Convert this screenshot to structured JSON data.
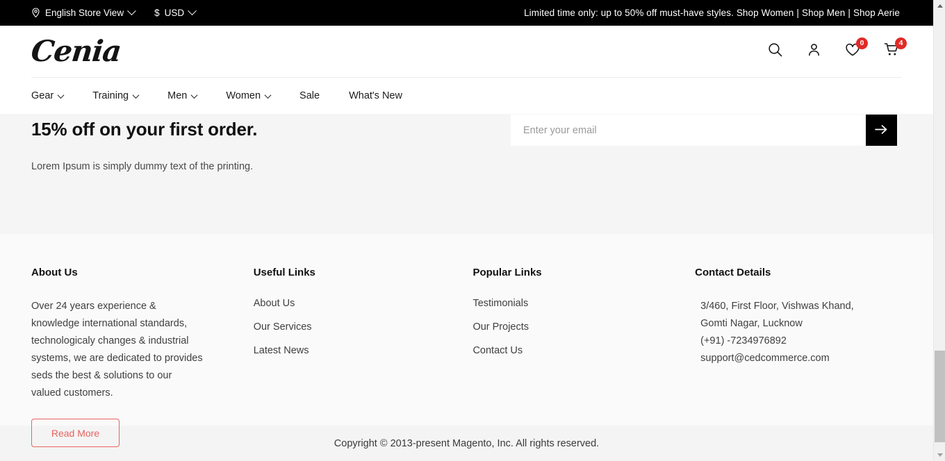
{
  "topbar": {
    "store_switcher": {
      "icon": "location-pin-icon",
      "label": "English Store View",
      "chevron": "chevron-down-icon"
    },
    "currency_switcher": {
      "icon": "dollar-icon",
      "symbol": "$",
      "label": "USD",
      "chevron": "chevron-down-icon"
    },
    "promo": {
      "text": "Limited time only: up to 50% off must-have styles.",
      "link1": "Shop Women",
      "sep1": "|",
      "link2": "Shop Men",
      "sep2": "|",
      "link3": "Shop Aerie"
    }
  },
  "header": {
    "logo": "Cenia",
    "icons": [
      {
        "name": "search-icon",
        "badge": null
      },
      {
        "name": "account-icon",
        "badge": null
      },
      {
        "name": "wishlist-heart-icon",
        "badge": "0"
      },
      {
        "name": "cart-icon",
        "badge": "4"
      }
    ],
    "badge_color": "#e02b27"
  },
  "nav": {
    "items": [
      {
        "label": "Gear",
        "has_chevron": true
      },
      {
        "label": "Training",
        "has_chevron": true
      },
      {
        "label": "Men",
        "has_chevron": true
      },
      {
        "label": "Women",
        "has_chevron": true
      },
      {
        "label": "Sale",
        "has_chevron": false
      },
      {
        "label": "What's New",
        "has_chevron": false
      }
    ]
  },
  "newsletter": {
    "title": "15% off on your first order.",
    "subtitle": "Lorem Ipsum is simply dummy text of the printing.",
    "email_placeholder": "Enter your email",
    "email_value": "",
    "submit_icon": "arrow-right-icon"
  },
  "footer": {
    "about": {
      "title": "About Us",
      "text": "Over 24 years experience & knowledge international standards, technologicaly changes & industrial systems, we are dedicated to provides seds the best & solutions to our valued customers.",
      "button": "Read More",
      "button_color": "#e8635f"
    },
    "useful": {
      "title": "Useful Links",
      "links": [
        "About Us",
        "Our Services",
        "Latest News"
      ]
    },
    "popular": {
      "title": "Popular Links",
      "links": [
        "Testimonials",
        "Our Projects",
        "Contact Us"
      ]
    },
    "contact": {
      "title": "Contact Details",
      "address": "3/460, First Floor, Vishwas Khand, Gomti Nagar, Lucknow",
      "phone": "(+91) -7234976892",
      "email": "support@cedcommerce.com"
    }
  },
  "copyright": {
    "text": "Copyright © 2013-present Magento, Inc. All rights reserved."
  }
}
